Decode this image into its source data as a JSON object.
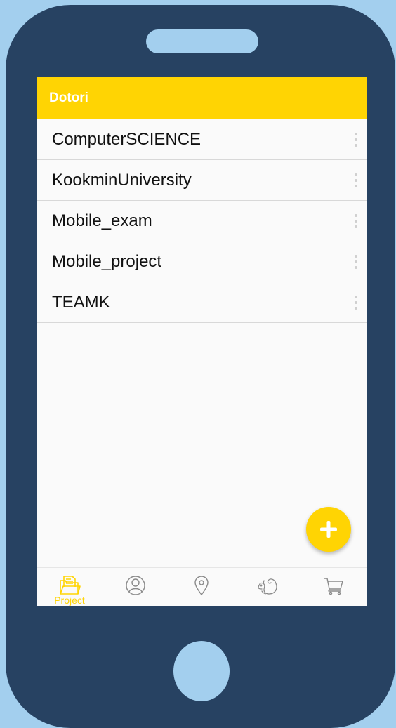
{
  "appbar": {
    "title": "Dotori"
  },
  "projects": [
    {
      "label": "ComputerSCIENCE"
    },
    {
      "label": "KookminUniversity"
    },
    {
      "label": "Mobile_exam"
    },
    {
      "label": "Mobile_project"
    },
    {
      "label": "TEAMK"
    }
  ],
  "bottom_nav": {
    "items": [
      {
        "icon": "folder-icon",
        "label": "Project",
        "active": true
      },
      {
        "icon": "user-icon",
        "active": false
      },
      {
        "icon": "location-pin-icon",
        "active": false
      },
      {
        "icon": "squirrel-icon",
        "active": false
      },
      {
        "icon": "cart-icon",
        "active": false
      }
    ]
  },
  "colors": {
    "accent": "#ffd403",
    "phone_body": "#274262",
    "background": "#a3cfee",
    "icon_inactive": "#8a8a8a"
  }
}
